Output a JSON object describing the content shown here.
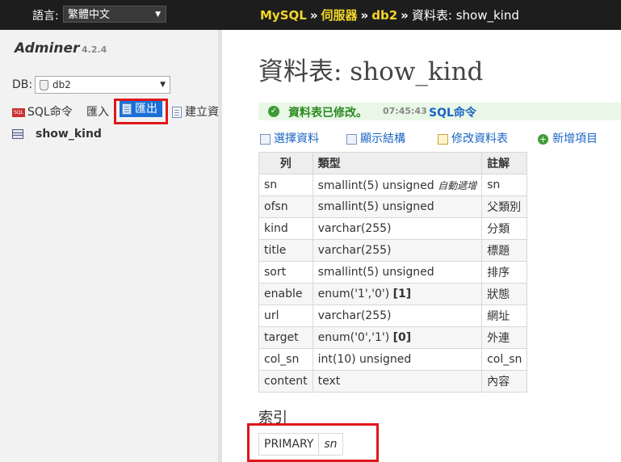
{
  "header": {
    "language_label": "語言:",
    "language_value": "繁體中文",
    "breadcrumb": [
      "MySQL",
      "伺服器",
      "db2"
    ],
    "breadcrumb_sep": "»",
    "current": "資料表: show_kind"
  },
  "sidebar": {
    "brand": "Adminer",
    "version": "4.2.4",
    "db_label": "DB:",
    "db_value": "db2",
    "links": {
      "sql": "SQL命令",
      "import": "匯入",
      "export": "匯出",
      "create": "建立資"
    },
    "table_name": "show_kind"
  },
  "main": {
    "title": "資料表: show_kind",
    "message": {
      "text": "資料表已修改。",
      "time": "07:45:43",
      "command": "SQL命令"
    },
    "actions": [
      "選擇資料",
      "顯示結構",
      "修改資料表",
      "新增項目"
    ],
    "columns_header": [
      "列",
      "類型",
      "註解"
    ],
    "rows": [
      {
        "name": "sn",
        "type": "smallint(5) unsigned",
        "extra": "自動遞增",
        "comment": "sn"
      },
      {
        "name": "ofsn",
        "type": "smallint(5) unsigned",
        "extra": "",
        "comment": "父類別"
      },
      {
        "name": "kind",
        "type": "varchar(255)",
        "extra": "",
        "comment": "分類"
      },
      {
        "name": "title",
        "type": "varchar(255)",
        "extra": "",
        "comment": "標題"
      },
      {
        "name": "sort",
        "type": "smallint(5) unsigned",
        "extra": "",
        "comment": "排序"
      },
      {
        "name": "enable",
        "type": "enum('1','0')",
        "extra": "",
        "default": "[1]",
        "comment": "狀態"
      },
      {
        "name": "url",
        "type": "varchar(255)",
        "extra": "",
        "comment": "網址"
      },
      {
        "name": "target",
        "type": "enum('0','1')",
        "extra": "",
        "default": "[0]",
        "comment": "外連"
      },
      {
        "name": "col_sn",
        "type": "int(10) unsigned",
        "extra": "",
        "comment": "col_sn"
      },
      {
        "name": "content",
        "type": "text",
        "extra": "",
        "comment": "內容"
      }
    ],
    "index_title": "索引",
    "index": {
      "type": "PRIMARY",
      "columns": "sn"
    }
  },
  "colors": {
    "topbar": "#1d1d1d",
    "breadcrumb_link": "#f3d62a",
    "link": "#1a64c4",
    "success_bg": "#e9f7e7",
    "success_text": "#2a8a20",
    "highlight": "#e0161b",
    "selected": "#1a70d8"
  }
}
